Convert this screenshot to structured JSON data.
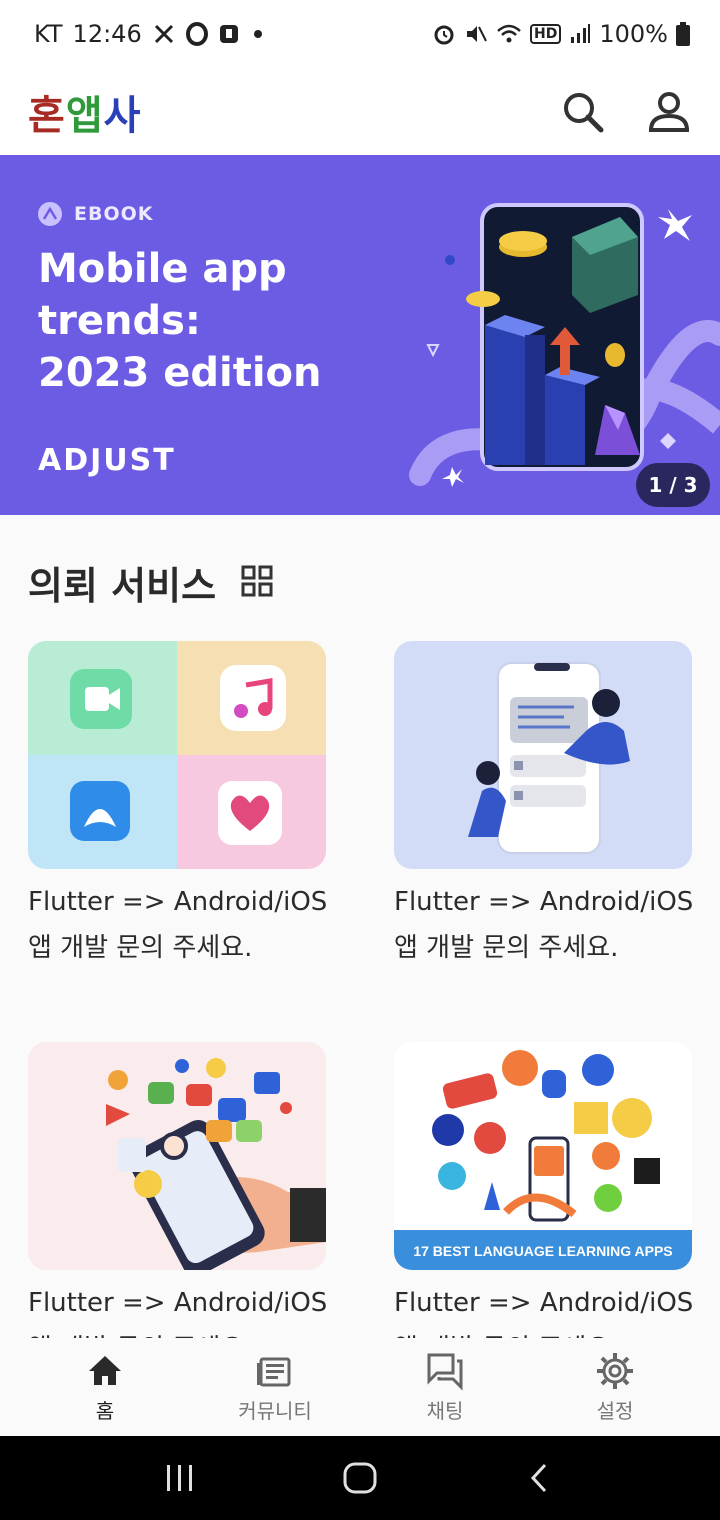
{
  "status_bar": {
    "carrier": "KT",
    "time": "12:46",
    "battery": "100%",
    "hd_label": "HD"
  },
  "app": {
    "title_part1": "혼",
    "title_part2": "앱",
    "title_part3": "사"
  },
  "banner": {
    "tag": "EBOOK",
    "headline": "Mobile app trends:\n2023 edition",
    "brand": "ADJUST",
    "pager": "1 / 3",
    "bg_color": "#6c5ce4"
  },
  "section": {
    "title": "의뢰 서비스"
  },
  "cards": [
    {
      "text": "Flutter => Android/iOS\n앱 개발 문의 주세요."
    },
    {
      "text": "Flutter => Android/iOS\n앱 개발 문의 주세요."
    },
    {
      "text": "Flutter => Android/iOS\n앱 개발 문의 주세요."
    },
    {
      "text": "Flutter => Android/iOS\n앱 개발 문의 주세요.",
      "image_caption": "17 BEST LANGUAGE LEARNING APPS"
    }
  ],
  "bottom_nav": [
    {
      "label": "홈",
      "icon": "home-icon",
      "active": true
    },
    {
      "label": "커뮤니티",
      "icon": "article-icon",
      "active": false
    },
    {
      "label": "채팅",
      "icon": "chat-icon",
      "active": false
    },
    {
      "label": "설정",
      "icon": "gear-icon",
      "active": false
    }
  ]
}
